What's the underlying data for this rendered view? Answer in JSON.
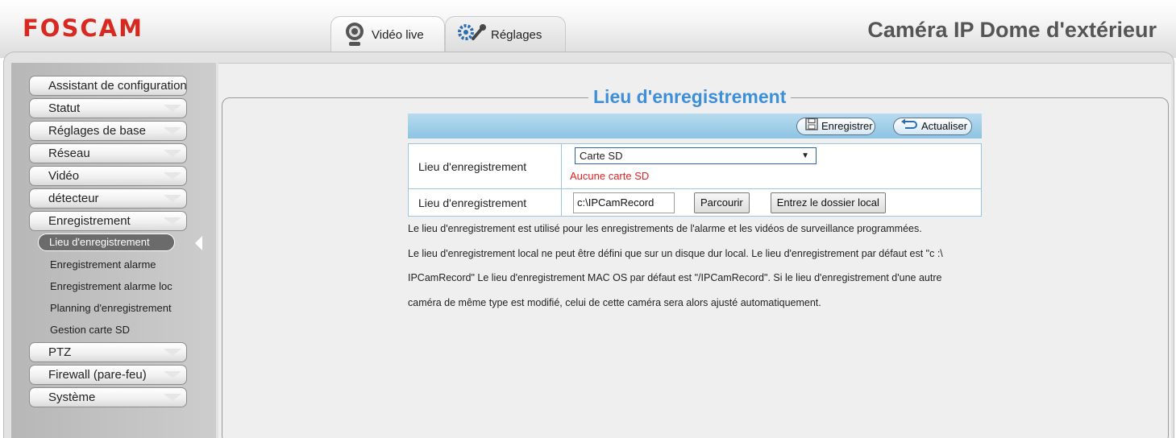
{
  "header": {
    "logo": "FOSCAM",
    "title": "Caméra IP Dome d'extérieur",
    "tabs": [
      {
        "label": "Vidéo live",
        "icon": "webcam-icon"
      },
      {
        "label": "Réglages",
        "icon": "gears-wrench-icon"
      }
    ]
  },
  "sidebar": {
    "items": [
      {
        "label": "Assistant de configuration"
      },
      {
        "label": "Statut"
      },
      {
        "label": "Réglages de base"
      },
      {
        "label": "Réseau"
      },
      {
        "label": "Vidéo"
      },
      {
        "label": "détecteur"
      },
      {
        "label": "Enregistrement"
      },
      {
        "label": "PTZ"
      },
      {
        "label": "Firewall (pare-feu)"
      },
      {
        "label": "Système"
      }
    ],
    "subitems": [
      {
        "label": "Lieu d'enregistrement",
        "active": true
      },
      {
        "label": "Enregistrement alarme"
      },
      {
        "label": "Enregistrement alarme loc"
      },
      {
        "label": "Planning d'enregistrement"
      },
      {
        "label": "Gestion carte SD"
      }
    ]
  },
  "main": {
    "section_title": "Lieu d'enregistrement",
    "toolbar": {
      "save_label": "Enregistrer",
      "refresh_label": "Actualiser"
    },
    "row1": {
      "label": "Lieu d'enregistrement",
      "selected_option": "Carte SD",
      "error": "Aucune carte SD"
    },
    "row2": {
      "label": "Lieu d'enregistrement",
      "path_value": "c:\\IPCamRecord",
      "browse_label": "Parcourir",
      "local_folder_label": "Entrez le dossier local"
    },
    "notes": [
      "Le lieu d'enregistrement est utilisé pour les enregistrements de l'alarme et les vidéos de surveillance programmées.",
      "Le lieu d'enregistrement local ne peut être défini que sur un disque dur local. Le lieu d'enregistrement par défaut est \"c :\\",
      "IPCamRecord\" Le lieu d'enregistrement MAC OS par défaut est \"/IPCamRecord\". Si le lieu d'enregistrement d'une autre",
      "caméra de même type est modifié, celui de cette caméra sera alors ajusté automatiquement."
    ]
  },
  "colors": {
    "brand": "#d8281f",
    "accent": "#3d8fd8",
    "error": "#e02020",
    "toolbar": "#a8d2ea"
  }
}
